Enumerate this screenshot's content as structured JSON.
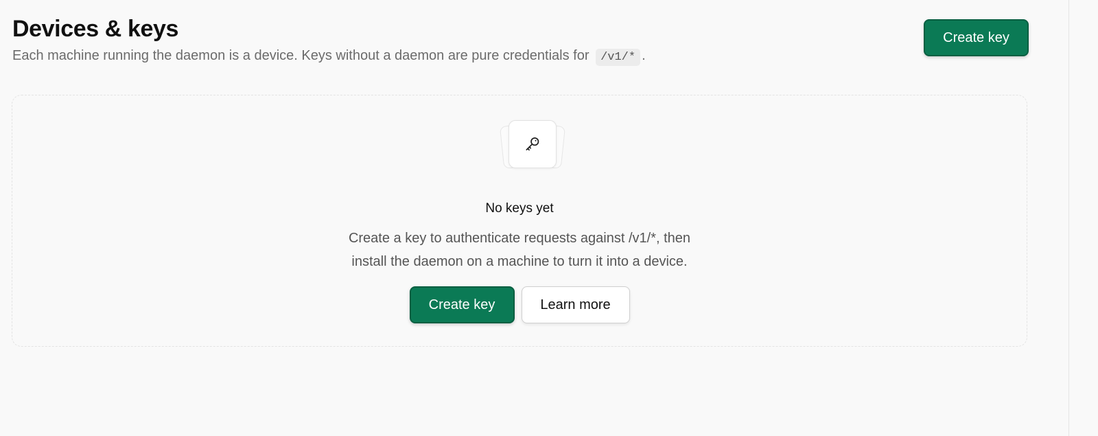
{
  "header": {
    "title": "Devices & keys",
    "subtitle_before": "Each machine running the daemon is a device. Keys without a daemon are pure credentials for",
    "subtitle_code": "/v1/*",
    "subtitle_after": ".",
    "create_label": "Create key"
  },
  "empty_state": {
    "icon": "key-icon",
    "title": "No keys yet",
    "description_line1": "Create a key to authenticate requests against /v1/*, then",
    "description_line2": "install the daemon on a machine to turn it into a device.",
    "primary_label": "Create key",
    "secondary_label": "Learn more"
  },
  "colors": {
    "primary": "#0b7a55",
    "background": "#f9f9f9"
  }
}
